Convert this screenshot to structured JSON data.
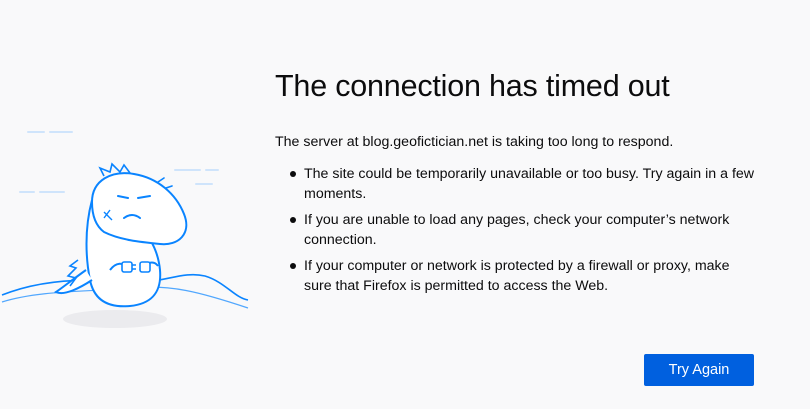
{
  "error": {
    "title": "The connection has timed out",
    "description": "The server at blog.geofictician.net is taking too long to respond.",
    "reasons": [
      "The site could be temporarily unavailable or too busy. Try again in a few moments.",
      "If you are unable to load any pages, check your computer’s network connection.",
      "If your computer or network is protected by a firewall or proxy, make sure that Firefox is permitted to access the Web."
    ]
  },
  "actions": {
    "try_again_label": "Try Again"
  },
  "illustration": {
    "name": "dino-with-unplugged-cable",
    "color": "#0a84ff",
    "fill": "#ffffff"
  },
  "colors": {
    "background": "#f9f9fa",
    "accent": "#0060df",
    "text": "#0c0c0d"
  }
}
